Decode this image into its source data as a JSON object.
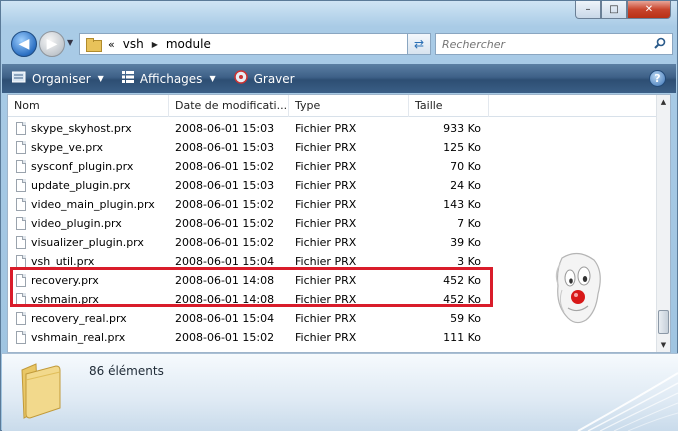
{
  "window": {
    "minimize_label": "–",
    "maximize_label": "□",
    "close_label": "✕"
  },
  "nav": {
    "back_icon": "◀",
    "forward_icon": "▶",
    "breadcrumb_sep": "«",
    "breadcrumbs": [
      "vsh",
      "module"
    ],
    "refresh_icon": "⇄",
    "search_placeholder": "Rechercher",
    "search_icon": "⌕"
  },
  "toolbar": {
    "organize_label": "Organiser",
    "views_label": "Affichages",
    "burn_label": "Graver",
    "help_label": "?"
  },
  "columns": {
    "name": "Nom",
    "date": "Date de modificati...",
    "type": "Type",
    "size": "Taille"
  },
  "files": [
    {
      "name": "skype_skyhost.prx",
      "date": "2008-06-01 15:03",
      "type": "Fichier PRX",
      "size": "933 Ko"
    },
    {
      "name": "skype_ve.prx",
      "date": "2008-06-01 15:03",
      "type": "Fichier PRX",
      "size": "125 Ko"
    },
    {
      "name": "sysconf_plugin.prx",
      "date": "2008-06-01 15:02",
      "type": "Fichier PRX",
      "size": "70 Ko"
    },
    {
      "name": "update_plugin.prx",
      "date": "2008-06-01 15:03",
      "type": "Fichier PRX",
      "size": "24 Ko"
    },
    {
      "name": "video_main_plugin.prx",
      "date": "2008-06-01 15:02",
      "type": "Fichier PRX",
      "size": "143 Ko"
    },
    {
      "name": "video_plugin.prx",
      "date": "2008-06-01 15:02",
      "type": "Fichier PRX",
      "size": "7 Ko"
    },
    {
      "name": "visualizer_plugin.prx",
      "date": "2008-06-01 15:02",
      "type": "Fichier PRX",
      "size": "39 Ko"
    },
    {
      "name": "vsh_util.prx",
      "date": "2008-06-01 15:04",
      "type": "Fichier PRX",
      "size": "3 Ko"
    },
    {
      "name": "recovery.prx",
      "date": "2008-06-01 14:08",
      "type": "Fichier PRX",
      "size": "452 Ko"
    },
    {
      "name": "vshmain.prx",
      "date": "2008-06-01 14:08",
      "type": "Fichier PRX",
      "size": "452 Ko"
    },
    {
      "name": "recovery_real.prx",
      "date": "2008-06-01 15:04",
      "type": "Fichier PRX",
      "size": "59 Ko"
    },
    {
      "name": "vshmain_real.prx",
      "date": "2008-06-01 15:02",
      "type": "Fichier PRX",
      "size": "111 Ko"
    }
  ],
  "details": {
    "count_label": "86 éléments"
  },
  "colors": {
    "highlight": "#d91c2a",
    "toolbar": "#3e6188"
  }
}
